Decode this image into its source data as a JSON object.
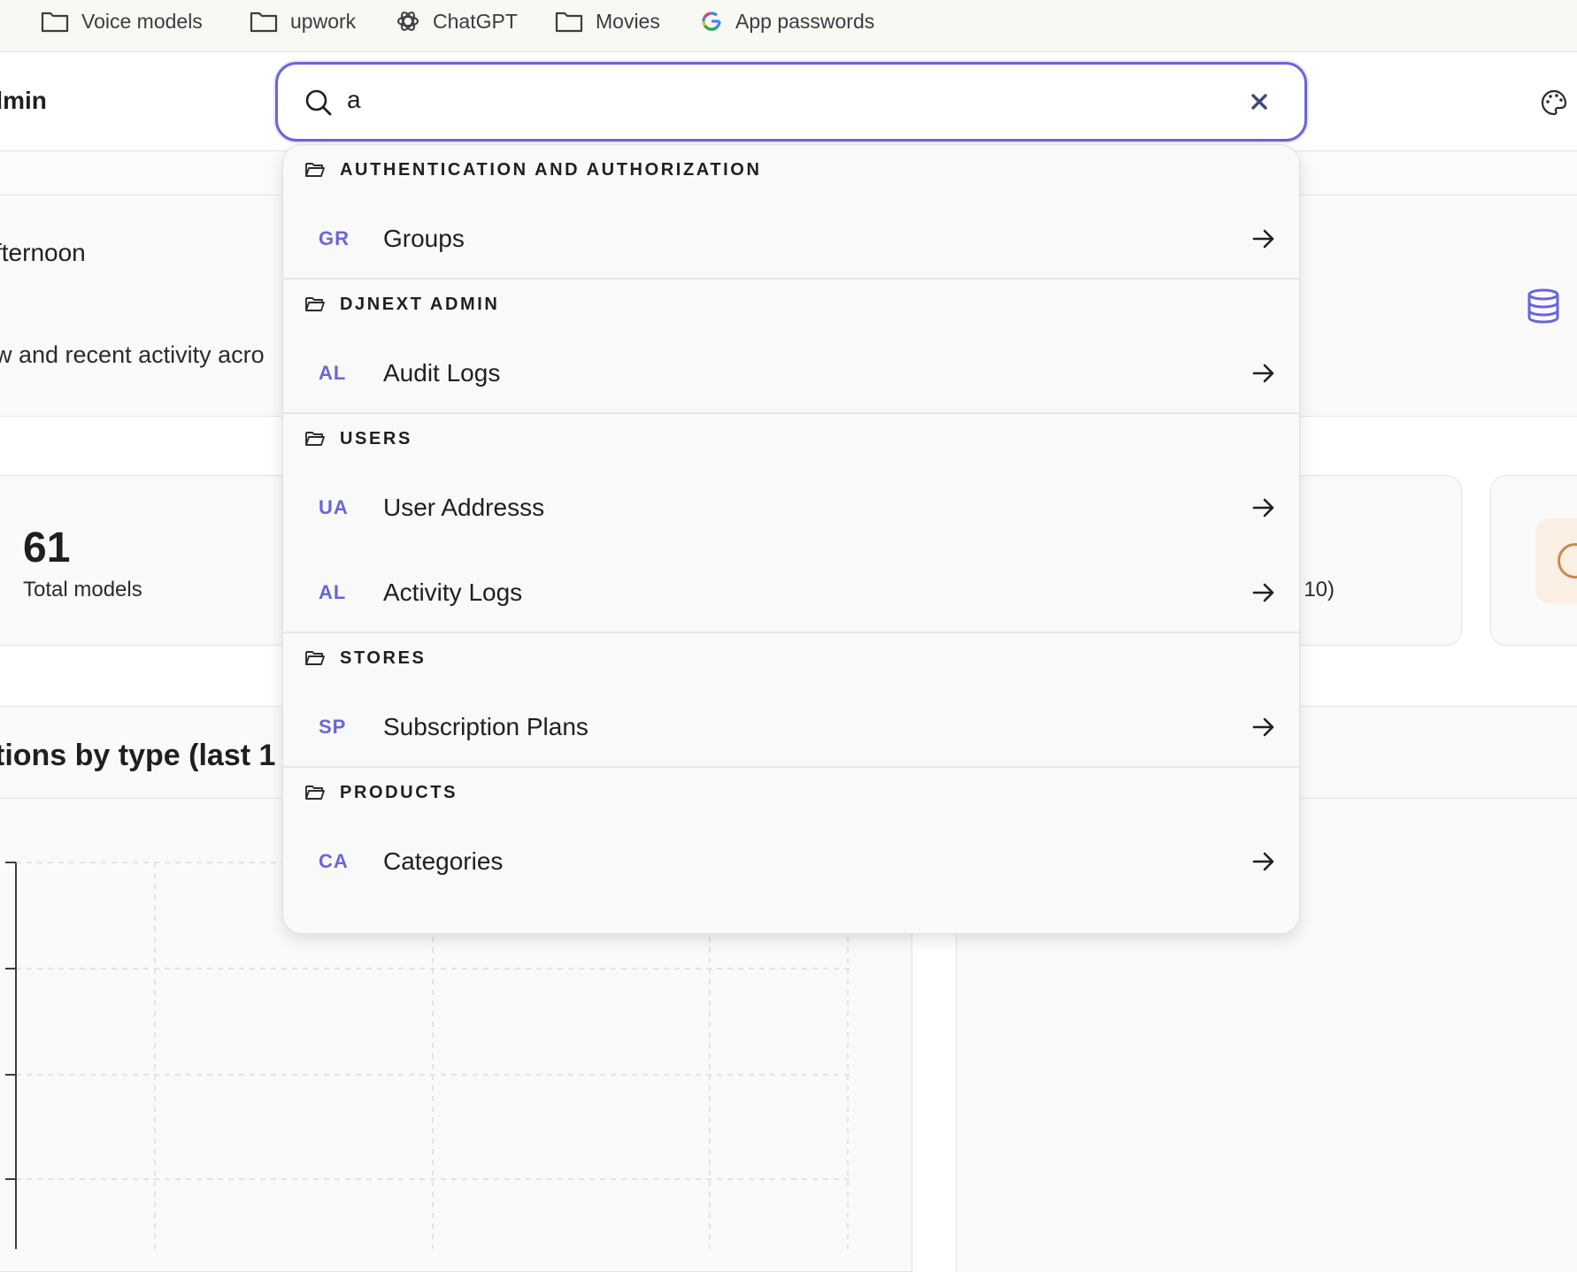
{
  "bookmarks": [
    {
      "label": "Voice models",
      "icon": "folder-icon"
    },
    {
      "label": "upwork",
      "icon": "folder-icon"
    },
    {
      "label": "ChatGPT",
      "icon": "chatgpt-icon"
    },
    {
      "label": "Movies",
      "icon": "folder-icon"
    },
    {
      "label": "App passwords",
      "icon": "google-icon"
    }
  ],
  "header": {
    "brand": "dmin"
  },
  "search": {
    "query": "a"
  },
  "results": [
    {
      "title": "AUTHENTICATION AND AUTHORIZATION",
      "items": [
        {
          "abbr": "GR",
          "label": "Groups"
        }
      ]
    },
    {
      "title": "DJNEXT ADMIN",
      "items": [
        {
          "abbr": "AL",
          "label": "Audit Logs"
        }
      ]
    },
    {
      "title": "USERS",
      "items": [
        {
          "abbr": "UA",
          "label": "User Addresss"
        },
        {
          "abbr": "AL",
          "label": "Activity Logs"
        }
      ]
    },
    {
      "title": "STORES",
      "items": [
        {
          "abbr": "SP",
          "label": "Subscription Plans"
        }
      ]
    },
    {
      "title": "PRODUCTS",
      "items": [
        {
          "abbr": "CA",
          "label": "Categories"
        }
      ]
    }
  ],
  "background": {
    "greeting": "fternoon",
    "subtitle": "w and recent activity acro",
    "stat_value": "61",
    "stat_label": "Total models",
    "partial_label": "t 10)",
    "chart_title": "tions by type (last 1"
  },
  "colors": {
    "accent": "#6965db",
    "badge_bg": "#fbeee2"
  }
}
